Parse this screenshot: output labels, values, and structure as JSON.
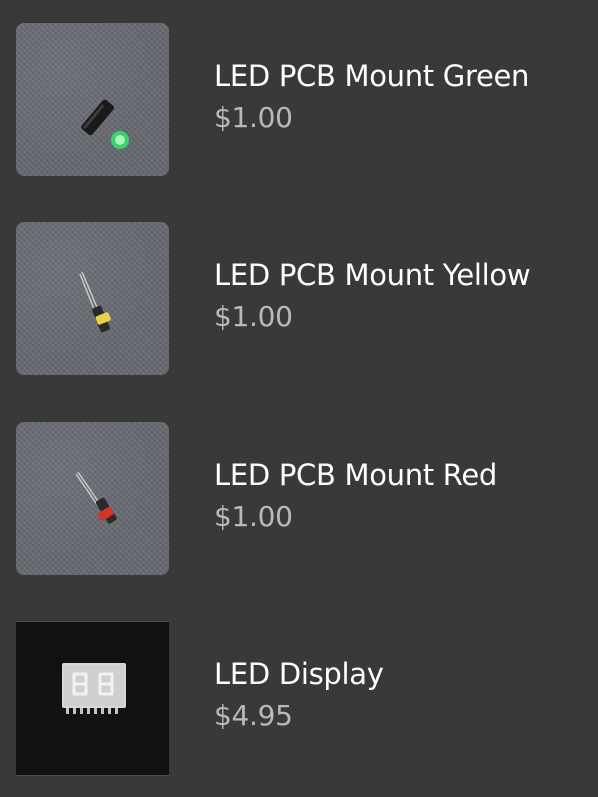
{
  "products": [
    {
      "name": "LED PCB Mount Green",
      "price": "$1.00",
      "image_icon": "green-led-icon"
    },
    {
      "name": "LED PCB Mount Yellow",
      "price": "$1.00",
      "image_icon": "yellow-led-icon"
    },
    {
      "name": "LED PCB Mount Red",
      "price": "$1.00",
      "image_icon": "red-led-icon"
    },
    {
      "name": "LED Display",
      "price": "$4.95",
      "image_icon": "seven-segment-display-icon"
    }
  ],
  "colors": {
    "background": "#393939",
    "title": "#ffffff",
    "price": "#b9b9b9",
    "green_led": "#39d36a",
    "yellow_led": "#e7d34a",
    "red_led": "#d0352a"
  }
}
